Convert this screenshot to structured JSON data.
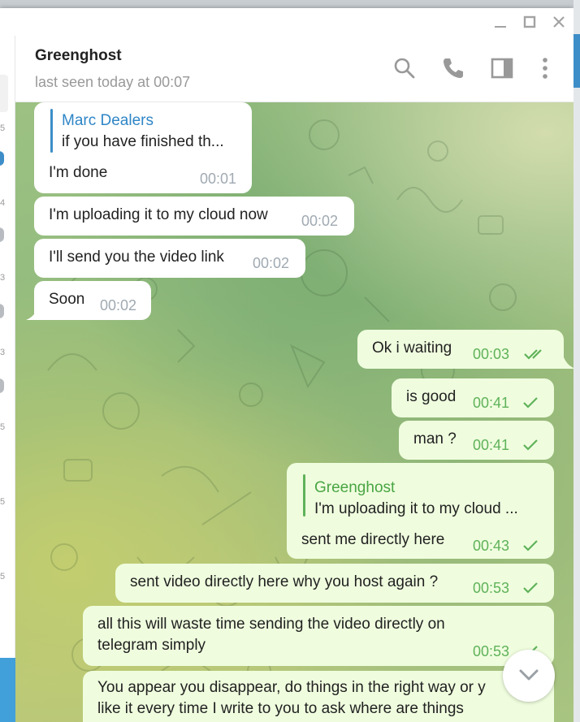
{
  "chat": {
    "peer_name": "Greenghost",
    "peer_status": "last seen today at 00:07"
  },
  "header_icons": [
    "search-icon",
    "phone-icon",
    "sidebar-toggle-icon",
    "more-vert-icon"
  ],
  "window_controls": [
    "minimize-icon",
    "maximize-icon",
    "close-icon"
  ],
  "left_strip": {
    "digits": [
      "5",
      "4",
      "3",
      "3",
      "5",
      "5",
      "5"
    ]
  },
  "messages": [
    {
      "dir": "in",
      "reply_name": "Marc Dealers",
      "reply_text": "if you have finished th...",
      "text": "I'm done",
      "time": "00:01"
    },
    {
      "dir": "in",
      "text": "I'm uploading it to my cloud now",
      "time": "00:02"
    },
    {
      "dir": "in",
      "text": "I'll send you the video link",
      "time": "00:02"
    },
    {
      "dir": "in",
      "text": "Soon",
      "time": "00:02"
    },
    {
      "dir": "out",
      "text": "Ok i waiting",
      "time": "00:03",
      "status": "read"
    },
    {
      "dir": "out",
      "text": "is good",
      "time": "00:41",
      "status": "sent"
    },
    {
      "dir": "out",
      "text": "man ?",
      "time": "00:41",
      "status": "sent"
    },
    {
      "dir": "out",
      "reply_name": "Greenghost",
      "reply_text": "I'm uploading it to my cloud ...",
      "text": "sent me directly here",
      "time": "00:43",
      "status": "sent"
    },
    {
      "dir": "out",
      "text": "sent video directly here why you host again ?",
      "time": "00:53",
      "status": "sent"
    },
    {
      "dir": "out",
      "lines": [
        "all this will waste time sending the video directly on",
        "telegram simply"
      ],
      "time": "00:53",
      "status": "sent"
    },
    {
      "dir": "out",
      "lines": [
        "You appear you disappear, do things in the right way or y",
        "like it every time I write to you to ask where are things"
      ]
    }
  ],
  "colors": {
    "incoming_bubble": "#ffffff",
    "outgoing_bubble": "#effdde",
    "outgoing_time": "#5fb25a",
    "accent_blue": "#419fd9"
  }
}
